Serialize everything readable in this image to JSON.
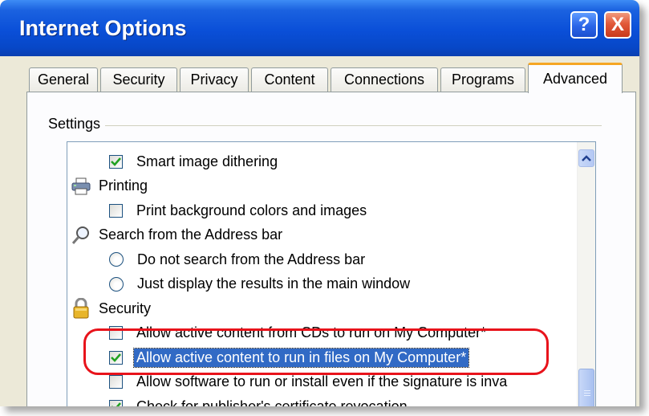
{
  "window": {
    "title": "Internet Options",
    "help_label": "?",
    "close_label": "X"
  },
  "tabs": [
    {
      "label": "General"
    },
    {
      "label": "Security"
    },
    {
      "label": "Privacy"
    },
    {
      "label": "Content"
    },
    {
      "label": "Connections"
    },
    {
      "label": "Programs"
    },
    {
      "label": "Advanced",
      "active": true
    }
  ],
  "settings": {
    "group_label": "Settings",
    "items": [
      {
        "kind": "checkbox",
        "label": "Smart image dithering",
        "checked": true
      },
      {
        "kind": "category",
        "label": "Printing",
        "icon": "printer-icon"
      },
      {
        "kind": "checkbox",
        "label": "Print background colors and images",
        "checked": false
      },
      {
        "kind": "category",
        "label": "Search from the Address bar",
        "icon": "magnifier-icon"
      },
      {
        "kind": "radio",
        "label": "Do not search from the Address bar",
        "checked": false
      },
      {
        "kind": "radio",
        "label": "Just display the results in the main window",
        "checked": false
      },
      {
        "kind": "category",
        "label": "Security",
        "icon": "padlock-icon"
      },
      {
        "kind": "checkbox",
        "label": "Allow active content from CDs to run on My Computer*",
        "checked": false
      },
      {
        "kind": "checkbox",
        "label": "Allow active content to run in files on My Computer*",
        "checked": true,
        "selected": true
      },
      {
        "kind": "checkbox",
        "label": "Allow software to run or install even if the signature is inva",
        "checked": false
      },
      {
        "kind": "checkbox",
        "label": "Check for publisher's certificate revocation",
        "checked": true
      }
    ]
  },
  "colors": {
    "titlebar": "#0a4fd8",
    "selection": "#316ac5",
    "annotation": "#e8131b",
    "tab_highlight": "#f5a623"
  }
}
